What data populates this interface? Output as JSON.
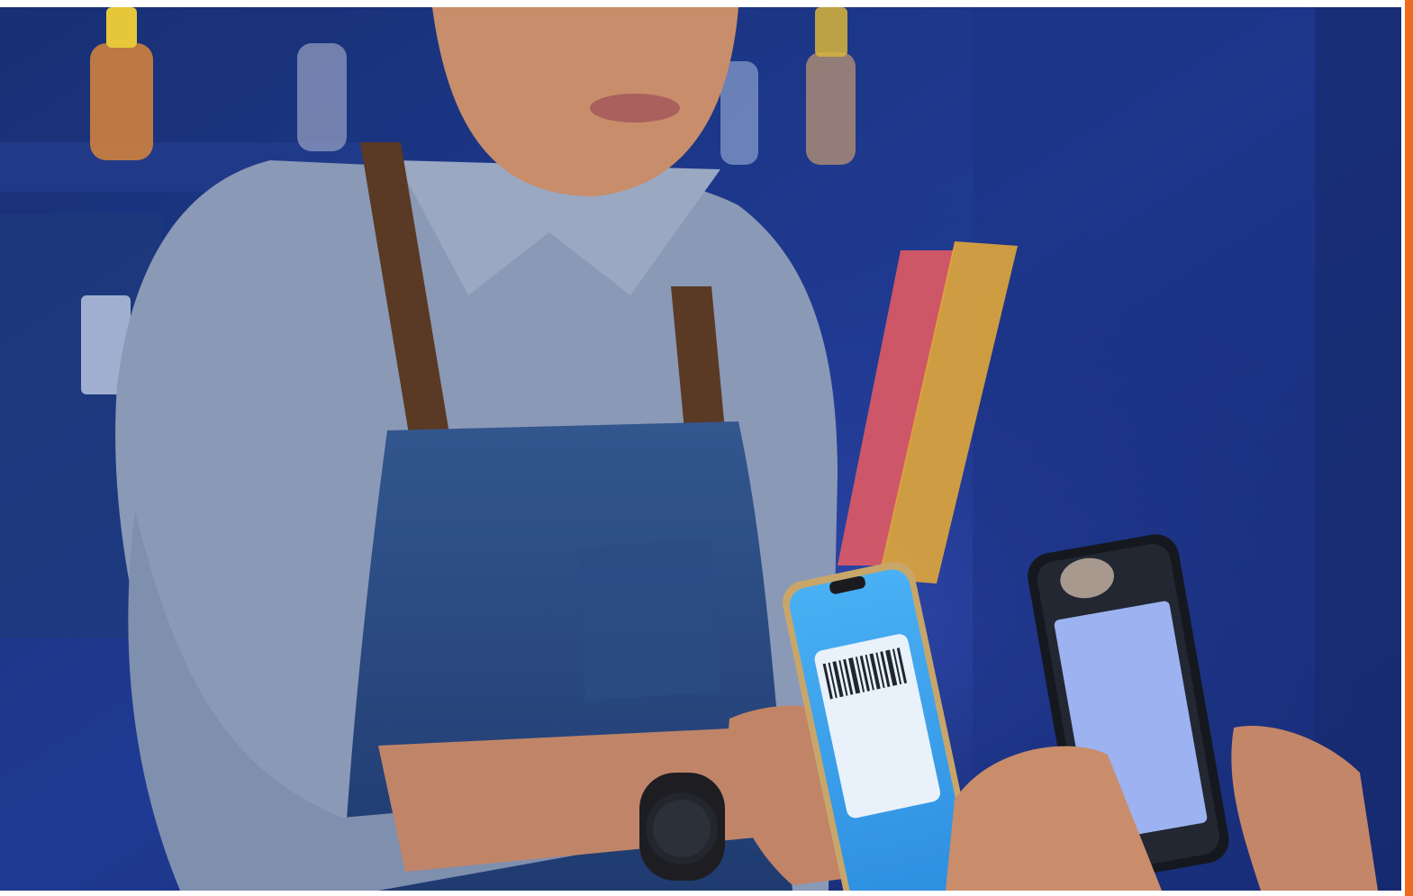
{
  "photo": {
    "subject": "",
    "scene": ""
  },
  "accent": {
    "color": "#f26b1d"
  },
  "palette": {
    "background": "#1a2f7a",
    "wall": "#22348c",
    "shirt": "#8e9cb8",
    "apron": "#2c4d86",
    "strap": "#5a3a24",
    "skin": "#c88d6a",
    "phone_screen": "#5fb5f0",
    "card": "#e9f1fb",
    "second_screen": "#9db2f0"
  }
}
